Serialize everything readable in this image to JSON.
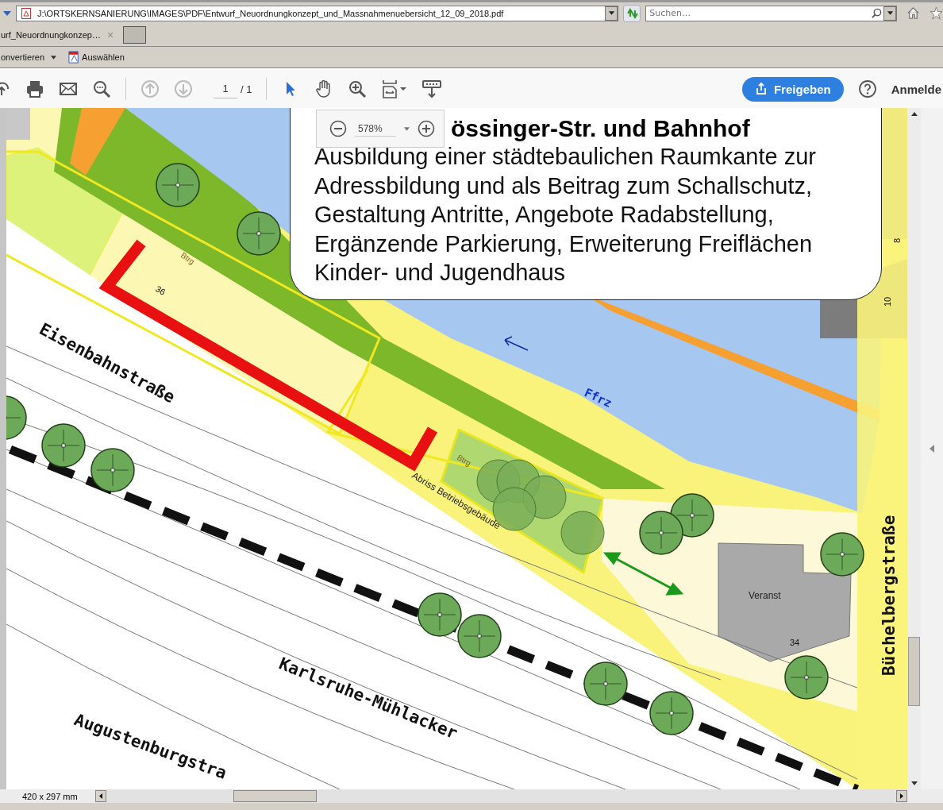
{
  "browser": {
    "address": "J:\\ORTSKERNSANIERUNG\\IMAGES\\PDF\\Entwurf_Neuordnungkonzept_und_Massnahmenuebersicht_12_09_2018.pdf",
    "search": {
      "placeholder": "Suchen…"
    }
  },
  "tabs": [
    {
      "label": "urf_Neuordnungkonzep…",
      "close": "×",
      "selected": true
    }
  ],
  "menu": [
    {
      "label": "onvertieren",
      "kind": "dropdown"
    },
    {
      "label": "Auswählen",
      "kind": "select"
    }
  ],
  "toolbar": {
    "page": "1",
    "page_total": "/ 1",
    "share": "Freigeben",
    "sign_in": "Anmelde"
  },
  "zoom": {
    "value": "578%"
  },
  "callout": {
    "title": "össinger-Str. und Bahnhof",
    "lines": [
      "Ausbildung einer städtebaulichen Raumkante zur",
      "Adressbildung und als Beitrag zum Schallschutz,",
      "Gestaltung Antritte, Angebote Radabstellung,",
      "Ergänzende Parkierung, Erweiterung Freiflächen",
      "Kinder- und Jugendhaus"
    ]
  },
  "map_labels": [
    {
      "text": "Btrg",
      "kind": "use"
    },
    {
      "text": "36",
      "kind": "number"
    },
    {
      "text": "Eisenbahnstraße",
      "kind": "street"
    },
    {
      "text": "Ffrz",
      "kind": "water"
    },
    {
      "text": "Btrg",
      "kind": "use"
    },
    {
      "text": "Abriss Betriebsgebäude",
      "kind": "note"
    },
    {
      "text": "Veranst",
      "kind": "note"
    },
    {
      "text": "34",
      "kind": "number"
    },
    {
      "text": "8",
      "kind": "number"
    },
    {
      "text": "10",
      "kind": "number"
    },
    {
      "text": "Büchelbergstraße",
      "kind": "street"
    },
    {
      "text": "Karlsruhe-Mühlacker",
      "kind": "street"
    },
    {
      "text": "Augustenburgstra",
      "kind": "street"
    }
  ],
  "status_bar": "420 x 297 mm"
}
